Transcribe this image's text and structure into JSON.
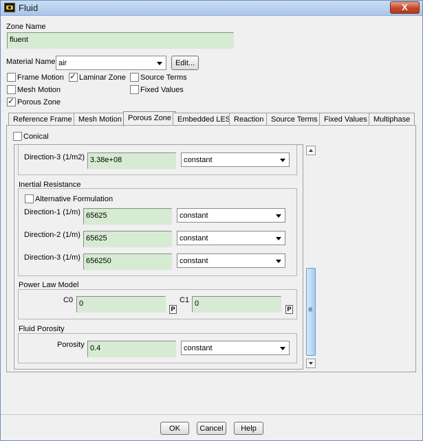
{
  "window": {
    "title": "Fluid",
    "close_label": "X"
  },
  "zone": {
    "label": "Zone Name",
    "value": "fluent"
  },
  "material": {
    "label": "Material Name",
    "value": "air",
    "edit_label": "Edit..."
  },
  "options": {
    "frame_motion": {
      "label": "Frame Motion",
      "checked": false
    },
    "laminar_zone": {
      "label": "Laminar Zone",
      "checked": true
    },
    "source_terms": {
      "label": "Source Terms",
      "checked": false
    },
    "mesh_motion": {
      "label": "Mesh Motion",
      "checked": false
    },
    "fixed_values": {
      "label": "Fixed Values",
      "checked": false
    },
    "porous_zone": {
      "label": "Porous Zone",
      "checked": true
    }
  },
  "tabs": [
    {
      "label": "Reference Frame"
    },
    {
      "label": "Mesh Motion"
    },
    {
      "label": "Porous Zone",
      "active": true
    },
    {
      "label": "Embedded LES"
    },
    {
      "label": "Reaction"
    },
    {
      "label": "Source Terms"
    },
    {
      "label": "Fixed Values"
    },
    {
      "label": "Multiphase"
    }
  ],
  "porous": {
    "conical_label": "Conical",
    "viscous_dir3": {
      "label": "Direction-3 (1/m2)",
      "value": "3.38e+08",
      "method": "constant"
    },
    "inertial": {
      "title": "Inertial Resistance",
      "alt_formulation_label": "Alternative Formulation",
      "dir1": {
        "label": "Direction-1 (1/m)",
        "value": "65625",
        "method": "constant"
      },
      "dir2": {
        "label": "Direction-2 (1/m)",
        "value": "65625",
        "method": "constant"
      },
      "dir3": {
        "label": "Direction-3 (1/m)",
        "value": "656250",
        "method": "constant"
      }
    },
    "power_law": {
      "title": "Power Law Model",
      "c0": {
        "label": "C0",
        "value": "0",
        "p_label": "P"
      },
      "c1": {
        "label": "C1",
        "value": "0",
        "p_label": "P"
      }
    },
    "porosity": {
      "title": "Fluid Porosity",
      "label": "Porosity",
      "value": "0.4",
      "method": "constant"
    }
  },
  "footer": {
    "ok_label": "OK",
    "cancel_label": "Cancel",
    "help_label": "Help"
  }
}
